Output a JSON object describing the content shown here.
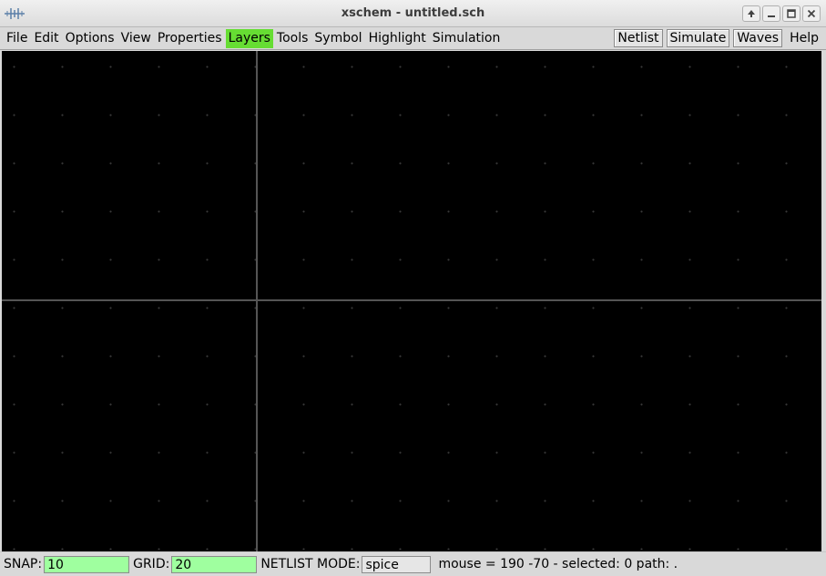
{
  "window": {
    "title": "xschem - untitled.sch",
    "app_icon": "schematic-icon",
    "controls": [
      "maximize-up-icon",
      "minimize-icon",
      "restore-icon",
      "close-icon"
    ]
  },
  "menubar": {
    "left": [
      "File",
      "Edit",
      "Options",
      "View",
      "Properties",
      "Layers",
      "Tools",
      "Symbol",
      "Highlight",
      "Simulation"
    ],
    "active": "Layers",
    "active_color": "#66dd33",
    "right": [
      "Netlist",
      "Simulate",
      "Waves",
      "Help"
    ]
  },
  "canvas": {
    "background": "#000000",
    "axis_color": "#555555"
  },
  "statusbar": {
    "snap_label": "SNAP:",
    "snap_value": "10",
    "grid_label": "GRID:",
    "grid_value": "20",
    "netlist_mode_label": "NETLIST MODE:",
    "netlist_mode_value": "spice",
    "mouse_info": "mouse = 190 -70 - selected: 0 path: ."
  }
}
